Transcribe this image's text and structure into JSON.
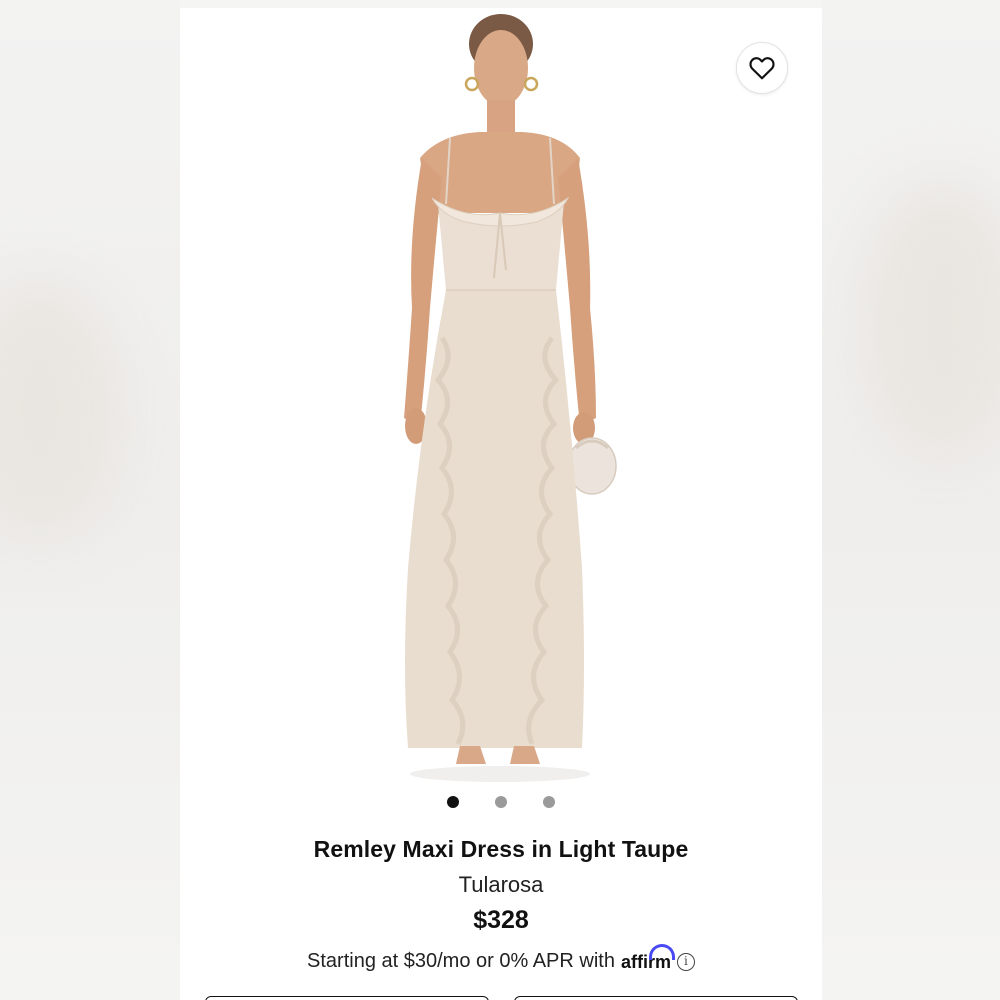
{
  "product": {
    "title": "Remley Maxi Dress in Light Taupe",
    "brand": "Tularosa",
    "price": "$328",
    "financing_prefix": "Starting at $30/mo or 0% APR with",
    "financing_provider": "affirm",
    "info_glyph": "i"
  },
  "gallery": {
    "image_count": 3,
    "active_index": 0
  },
  "colors": {
    "dress": "#e9ddcf",
    "accent_affirm": "#4a4af4",
    "text": "#111111"
  },
  "icons": {
    "favorite": "heart-outline-icon",
    "info": "info-circle-icon"
  }
}
